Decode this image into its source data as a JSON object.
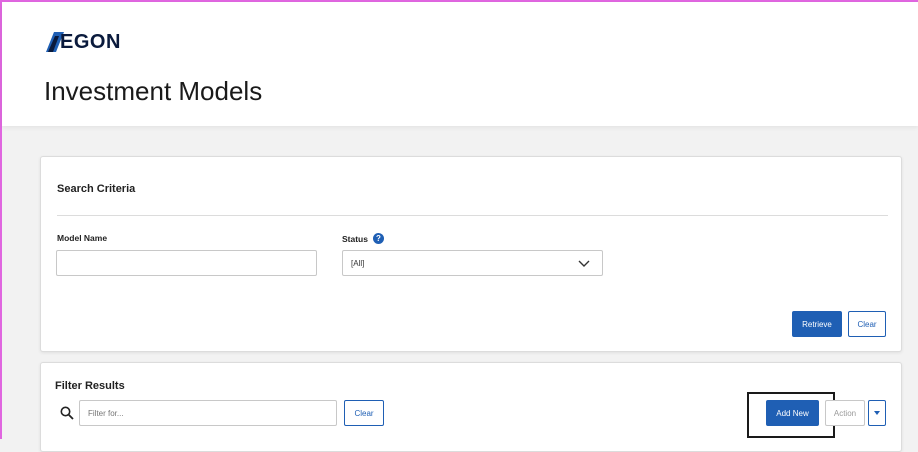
{
  "header": {
    "logo_text": "EGON",
    "page_title": "Investment Models"
  },
  "search_criteria": {
    "title": "Search Criteria",
    "model_name": {
      "label": "Model Name",
      "value": "",
      "placeholder": ""
    },
    "status": {
      "label": "Status",
      "help_icon": "?",
      "selected": "[All]"
    },
    "retrieve_label": "Retrieve",
    "clear_label": "Clear"
  },
  "filter_results": {
    "title": "Filter Results",
    "filter_placeholder": "Filter for...",
    "clear_label": "Clear",
    "add_new_label": "Add New",
    "action_label": "Action"
  },
  "colors": {
    "brand_navy": "#0a1a3c",
    "accent_blue": "#1f5fb4",
    "highlight": "#1a1a1a"
  },
  "icons": {
    "logo": "aegon-logo-icon",
    "help": "help-circle-icon",
    "chevron": "chevron-down-icon",
    "search": "search-icon",
    "caret": "caret-down-icon"
  }
}
